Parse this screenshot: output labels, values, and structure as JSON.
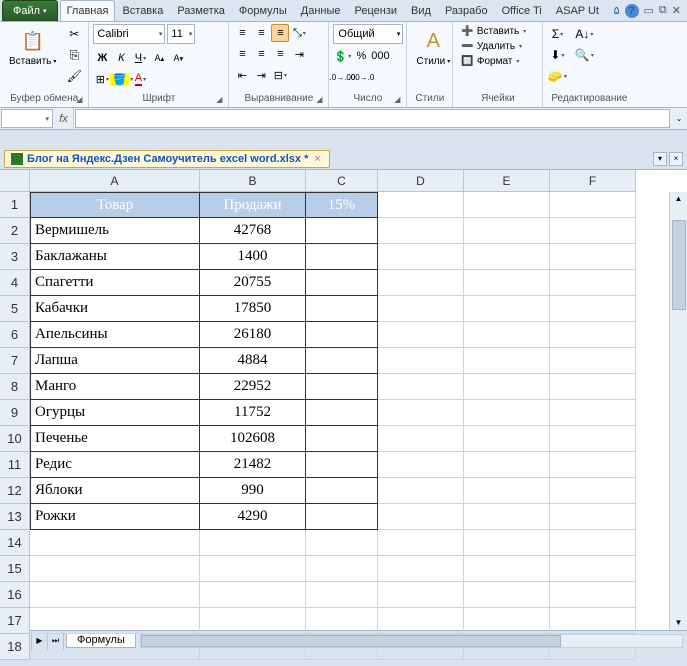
{
  "ribbon": {
    "file": "Файл",
    "tabs": [
      "Главная",
      "Вставка",
      "Разметка",
      "Формулы",
      "Данные",
      "Рецензи",
      "Вид",
      "Разрабо",
      "Office Ti",
      "ASAP Ut"
    ],
    "activeTab": 0
  },
  "groups": {
    "clipboard": {
      "label": "Буфер обмена",
      "paste": "Вставить"
    },
    "font": {
      "label": "Шрифт",
      "name": "Calibri",
      "size": "11"
    },
    "alignment": {
      "label": "Выравнивание"
    },
    "number": {
      "label": "Число",
      "format": "Общий"
    },
    "styles": {
      "label": "Стили",
      "btn": "Стили"
    },
    "cells": {
      "label": "Ячейки",
      "insert": "Вставить",
      "delete": "Удалить",
      "format": "Формат"
    },
    "editing": {
      "label": "Редактирование"
    }
  },
  "formulaBar": {
    "nameBox": "",
    "formula": ""
  },
  "docTab": {
    "title": "Блог на Яндекс.Дзен Самоучитель excel word.xlsx *"
  },
  "columns": [
    "A",
    "B",
    "C",
    "D",
    "E",
    "F"
  ],
  "headers": {
    "c1": "Товар",
    "c2": "Продажи",
    "c3": "15%"
  },
  "rows": [
    {
      "a": "Вермишель",
      "b": "42768"
    },
    {
      "a": "Баклажаны",
      "b": "1400"
    },
    {
      "a": "Спагетти",
      "b": "20755"
    },
    {
      "a": "Кабачки",
      "b": "17850"
    },
    {
      "a": "Апельсины",
      "b": "26180"
    },
    {
      "a": "Лапша",
      "b": "4884"
    },
    {
      "a": "Манго",
      "b": "22952"
    },
    {
      "a": "Огурцы",
      "b": "11752"
    },
    {
      "a": "Печенье",
      "b": "102608"
    },
    {
      "a": "Редис",
      "b": "21482"
    },
    {
      "a": "Яблоки",
      "b": "990"
    },
    {
      "a": "Рожки",
      "b": "4290"
    }
  ],
  "sheetTab": "Формулы"
}
